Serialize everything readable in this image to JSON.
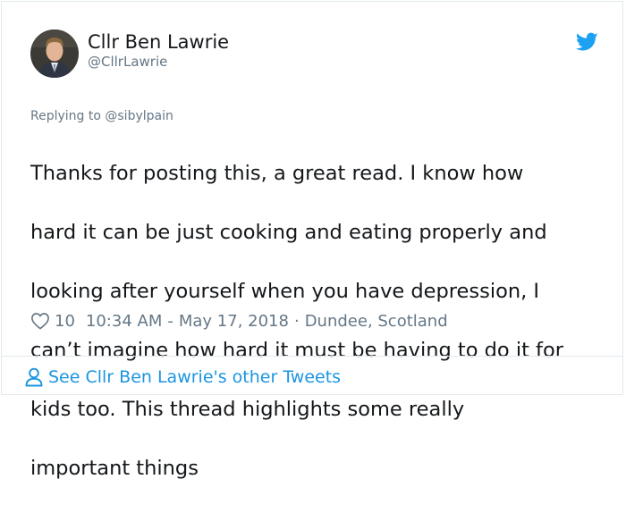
{
  "tweet": {
    "author_name": "Cllr Ben Lawrie",
    "author_handle": "@CllrLawrie",
    "reply_prefix": "Replying to",
    "reply_handle": "@sibylpain",
    "text_lines": [
      "Thanks for posting this, a great read. I know how",
      "hard it can be just cooking and eating properly and",
      "looking after yourself when you have depression, I",
      "can’t imagine how hard it must be having to do it for",
      "kids too. This thread highlights some really",
      "important things"
    ],
    "likes": "10",
    "time": "10:34 AM",
    "date": "May 17, 2018",
    "location": "Dundee, Scotland"
  },
  "footer": {
    "link_label": "See Cllr Ben Lawrie's other Tweets"
  },
  "icons": {
    "brand": "twitter-bird-icon",
    "like": "heart-icon",
    "footer": "person-icon"
  },
  "colors": {
    "brand_blue": "#1da1f2",
    "link_blue": "#1b95e0",
    "muted_gray": "#657786",
    "text": "#14171a",
    "border": "#e1e8ed"
  }
}
